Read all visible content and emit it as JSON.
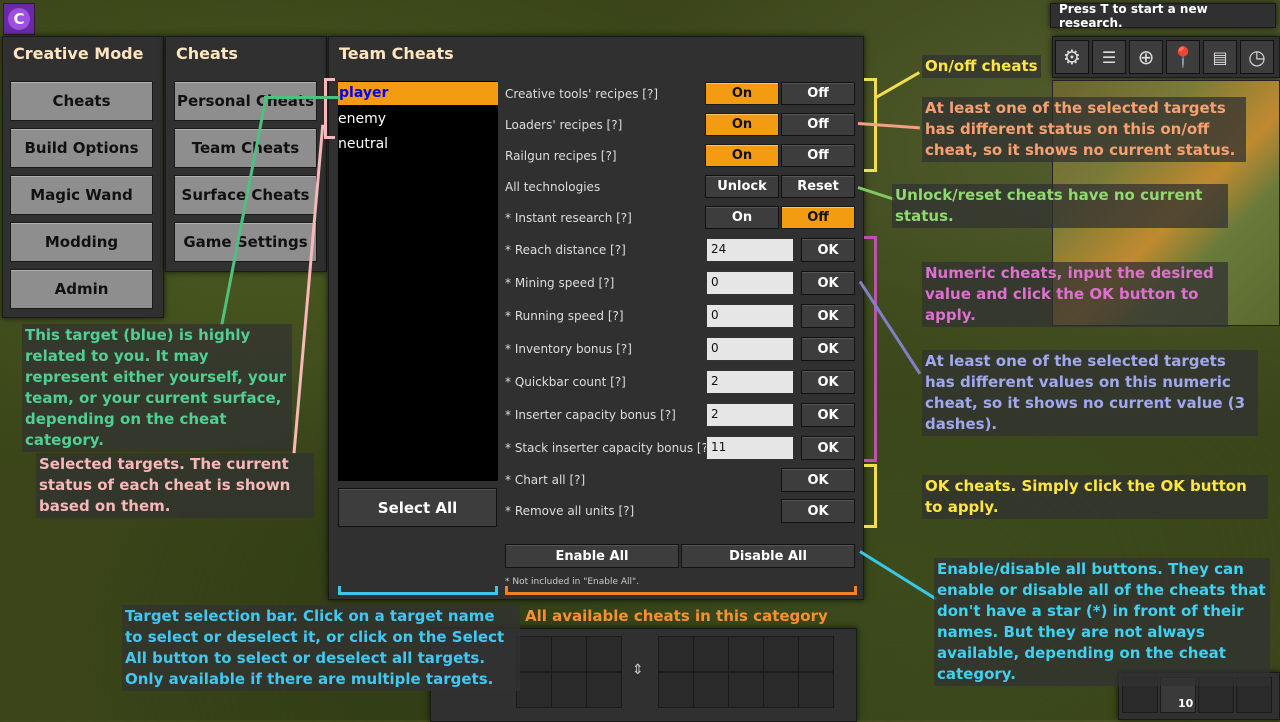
{
  "colors": {
    "accent": "#f39c12",
    "selected_target": "#0000ee"
  },
  "mod_icon_letter": "C",
  "research_hint": "Press T to start a new research.",
  "creative": {
    "title": "Creative Mode",
    "buttons": [
      "Cheats",
      "Build Options",
      "Magic Wand",
      "Modding",
      "Admin"
    ]
  },
  "cheats_menu": {
    "title": "Cheats",
    "buttons": [
      "Personal Cheats",
      "Team Cheats",
      "Surface Cheats",
      "Game Settings"
    ]
  },
  "team": {
    "title": "Team Cheats",
    "targets": [
      "player",
      "enemy",
      "neutral"
    ],
    "select_all": "Select All",
    "rows": [
      {
        "label": "Creative tools' recipes [?]",
        "a": "On",
        "b": "Off"
      },
      {
        "label": "Loaders' recipes [?]",
        "a": "On",
        "b": "Off"
      },
      {
        "label": "Railgun recipes [?]",
        "a": "On",
        "b": "Off"
      },
      {
        "label": "All technologies",
        "a": "Unlock",
        "b": "Reset"
      },
      {
        "label": "* Instant research [?]",
        "a": "On",
        "b": "Off"
      },
      {
        "label": "* Reach distance [?]",
        "value": "24",
        "ok": "OK"
      },
      {
        "label": "* Mining speed [?]",
        "value": "0",
        "ok": "OK"
      },
      {
        "label": "* Running speed [?]",
        "value": "0",
        "ok": "OK"
      },
      {
        "label": "* Inventory bonus [?]",
        "value": "0",
        "ok": "OK"
      },
      {
        "label": "* Quickbar count [?]",
        "value": "2",
        "ok": "OK"
      },
      {
        "label": "* Inserter capacity bonus [?]",
        "value": "2",
        "ok": "OK"
      },
      {
        "label": "* Stack inserter capacity bonus [?]",
        "value": "11",
        "ok": "OK"
      },
      {
        "label": "* Chart all [?]",
        "ok": "OK"
      },
      {
        "label": "* Remove all units [?]",
        "ok": "OK"
      }
    ],
    "enable_all": "Enable All",
    "disable_all": "Disable All",
    "footnote": "* Not included in \"Enable All\"."
  },
  "annotations": {
    "onoff": "On/off cheats",
    "mixed_status": "At least one of the selected targets has different status on this on/off cheat, so it shows no current status.",
    "unlock_reset": "Unlock/reset cheats have no current status.",
    "numeric": "Numeric cheats, input the desired value and click the OK button to apply.",
    "mixed_value": "At least one of the selected targets has different values on this numeric cheat, so it shows no current value (3 dashes).",
    "ok_cheats": "OK cheats. Simply click the OK button to apply.",
    "enable_disable": "Enable/disable all buttons. They can enable or disable all of the cheats that don't have a star (*) in front of their names. But they are not always available, depending on the cheat category.",
    "target_blue": "This target (blue) is highly related to you. It may represent either yourself, your team, or your current surface, depending on the cheat category.",
    "selected_targets": "Selected targets. The current status of each cheat is shown based on them.",
    "target_bar": "Target selection bar. Click on a target name to select or deselect it, or click on the Select All button to select or deselect all targets. Only available if there are multiple targets.",
    "all_cheats": "All available cheats in this category"
  },
  "hotbar_count": "10"
}
